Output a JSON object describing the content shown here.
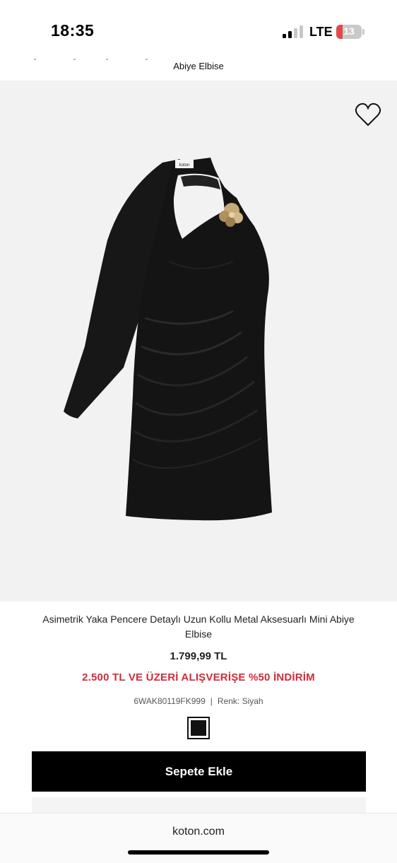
{
  "status_bar": {
    "time": "18:35",
    "network": "LTE",
    "battery": "13"
  },
  "header": {
    "title": "Abiye Elbise"
  },
  "product": {
    "title": "Asimetrik Yaka Pencere Detaylı Uzun Kollu Metal Aksesuarlı Mini Abiye Elbise",
    "price": "1.799,99 TL",
    "promo": "2.500 TL VE ÜZERİ ALIŞVERİŞE %50 İNDİRİM",
    "sku": "6WAK80119FK999",
    "separator": "|",
    "color_label": "Renk: Siyah",
    "swatch_color": "#111111",
    "image_icon": "dress-image",
    "label_brand": "koton"
  },
  "actions": {
    "add_to_cart": "Sepete Ekle",
    "favorite_icon": "heart-icon"
  },
  "browser": {
    "url": "koton.com"
  },
  "colors": {
    "promo_red": "#d22a3b",
    "image_bg": "#f2f2f2",
    "button_bg": "#000000"
  }
}
